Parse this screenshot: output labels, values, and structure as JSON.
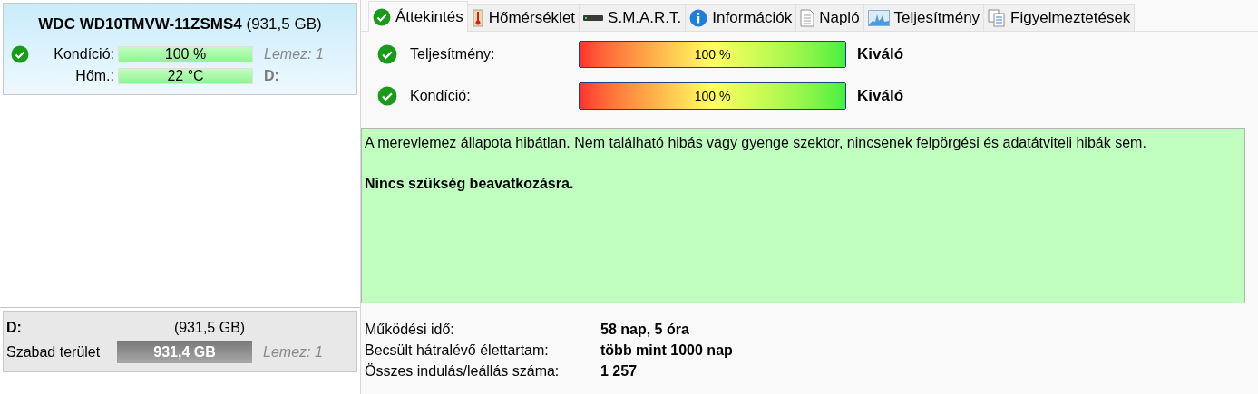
{
  "disk": {
    "model": "WDC WD10TMVW-11ZSMS4",
    "size": "(931,5 GB)",
    "status_ok": true,
    "rows": [
      {
        "label": "Kondíció:",
        "value": "100 %",
        "level": 1,
        "note": "Lemez: 1",
        "kind": "italic"
      },
      {
        "label": "Hőm.:",
        "value": "22 °C",
        "level": 1,
        "note": "D:",
        "kind": "bold"
      }
    ]
  },
  "partition": {
    "letter": "D:",
    "size": "(931,5 GB)",
    "free_label": "Szabad terület",
    "free_value": "931,4 GB",
    "level": 1,
    "note": "Lemez: 1"
  },
  "tabs": [
    {
      "label": "Áttekintés",
      "kind": "check",
      "selected": true
    },
    {
      "label": "Hőmérséklet",
      "kind": "thermometer",
      "selected": false
    },
    {
      "label": "S.M.A.R.T.",
      "kind": "drive",
      "selected": false
    },
    {
      "label": "Információk",
      "kind": "info",
      "selected": false
    },
    {
      "label": "Napló",
      "kind": "document",
      "selected": false
    },
    {
      "label": "Teljesítmény",
      "kind": "chart",
      "selected": false
    },
    {
      "label": "Figyelmeztetések",
      "kind": "copy",
      "selected": false
    }
  ],
  "ratings": [
    {
      "label": "Teljesítmény:",
      "ok": true,
      "value": "100 %",
      "level": 1,
      "verdict": "Kiváló"
    },
    {
      "label": "Kondíció:",
      "ok": true,
      "value": "100 %",
      "level": 1,
      "verdict": "Kiváló"
    }
  ],
  "message": {
    "text": "A merevlemez állapota hibátlan. Nem található hibás vagy gyenge szektor, nincsenek felpörgési és adatátviteli hibák sem.",
    "action": "Nincs szükség beavatkozásra."
  },
  "stats": [
    {
      "label": "Működési idő:",
      "value": "58 nap, 5 óra"
    },
    {
      "label": "Becsült hátralévő élettartam:",
      "value": "több mint 1000 nap"
    },
    {
      "label": "Összes indulás/leállás száma:",
      "value": "1 257"
    }
  ]
}
